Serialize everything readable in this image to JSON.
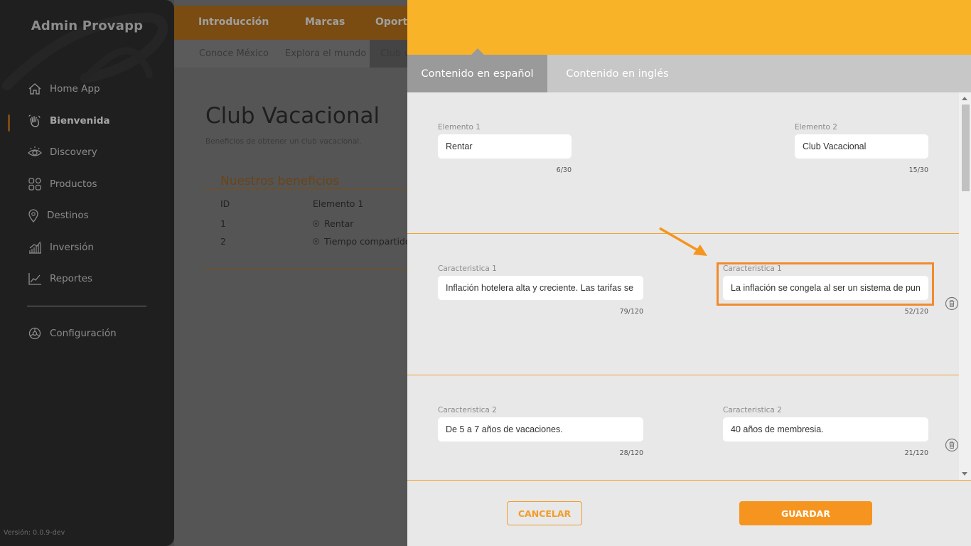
{
  "sidebar": {
    "app_title": "Admin Provapp",
    "items": [
      {
        "label": "Home App",
        "icon": "home-icon"
      },
      {
        "label": "Bienvenida",
        "icon": "waving-hand-icon",
        "active": true
      },
      {
        "label": "Discovery",
        "icon": "eye-icon"
      },
      {
        "label": "Productos",
        "icon": "grid-icon"
      },
      {
        "label": "Destinos",
        "icon": "location-pin-icon"
      },
      {
        "label": "Inversión",
        "icon": "bar-chart-icon"
      },
      {
        "label": "Reportes",
        "icon": "line-chart-icon"
      },
      {
        "label": "Configuración",
        "icon": "gear-icon"
      }
    ],
    "version": "Versión: 0.0.9-dev"
  },
  "background_page": {
    "top_tabs": [
      "Introducción",
      "Marcas",
      "Oport"
    ],
    "sub_tabs": [
      "Conoce México",
      "Explora el mundo",
      "Club v"
    ],
    "title": "Club Vacacional",
    "subtitle": "Beneficios de obtener un club vacacional.",
    "section_title": "Nuestros beneficios",
    "table": {
      "headers": [
        "ID",
        "Elemento 1"
      ],
      "rows": [
        {
          "id": "1",
          "value": "Rentar"
        },
        {
          "id": "2",
          "value": "Tiempo compartido"
        }
      ]
    }
  },
  "drawer": {
    "tabs": [
      {
        "label": "Contenido en español",
        "active": true
      },
      {
        "label": "Contenido en inglés",
        "active": false
      }
    ],
    "rows": [
      {
        "left": {
          "label": "Elemento 1",
          "value": "Rentar",
          "counter": "6/30"
        },
        "right": {
          "label": "Elemento 2",
          "value": "Club Vacacional",
          "counter": "15/30"
        }
      },
      {
        "left": {
          "label": "Caracteristica 1",
          "value": "Inflación hotelera alta y creciente. Las tarifas se in",
          "counter": "79/120"
        },
        "right": {
          "label": "Caracteristica 1",
          "value": "La inflación se congela al ser un sistema de punto",
          "counter": "52/120"
        }
      },
      {
        "left": {
          "label": "Caracteristica 2",
          "value": "De 5 a 7 años de vacaciones.",
          "counter": "28/120"
        },
        "right": {
          "label": "Caracteristica 2",
          "value": "40 años de membresia.",
          "counter": "21/120"
        }
      }
    ],
    "buttons": {
      "cancel": "CANCELAR",
      "save": "GUARDAR"
    }
  },
  "colors": {
    "accent": "#f8b328",
    "button_orange": "#f5951f",
    "highlight": "#f08c2e",
    "sidebar_bg": "#1f1f1f"
  }
}
